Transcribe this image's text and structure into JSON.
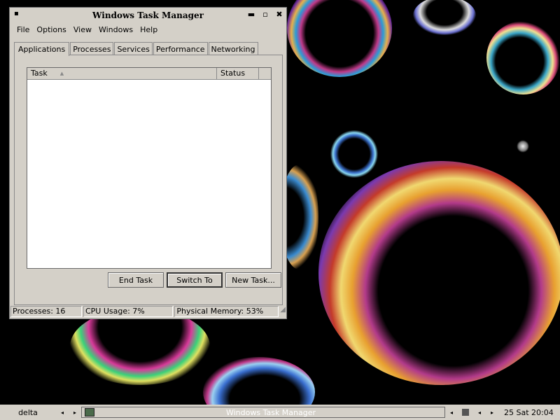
{
  "window": {
    "title": "Windows Task Manager",
    "sysmenu": "▪",
    "controls": {
      "minimize": "▬",
      "maximize": "▫",
      "close": "✖"
    }
  },
  "menu": [
    "File",
    "Options",
    "View",
    "Windows",
    "Help"
  ],
  "tabs": [
    {
      "label": "Applications",
      "active": true
    },
    {
      "label": "Processes",
      "active": false
    },
    {
      "label": "Services",
      "active": false
    },
    {
      "label": "Performance",
      "active": false
    },
    {
      "label": "Networking",
      "active": false
    }
  ],
  "task_list": {
    "columns": [
      "Task",
      "Status"
    ],
    "rows": []
  },
  "buttons": {
    "end_task": "End Task",
    "switch_to": "Switch To",
    "new_task": "New Task..."
  },
  "status": {
    "processes": "Processes: 16",
    "cpu": "CPU Usage: 7%",
    "memory": "Physical Memory: 53%"
  },
  "taskbar": {
    "desktop_name": "delta",
    "left_arrow": "◂",
    "right_arrow": "▸",
    "task_label": "Windows Task Manager",
    "clock": "25 Sat 20:04"
  }
}
